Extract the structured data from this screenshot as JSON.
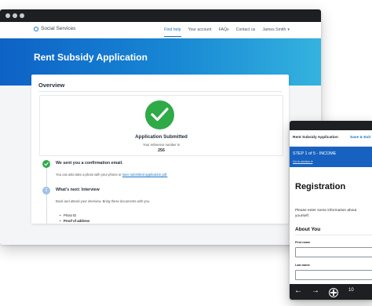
{
  "desktop": {
    "nav": {
      "brand": "Social Services",
      "links": [
        "Find help",
        "Your account",
        "FAQs",
        "Contact us"
      ],
      "user": "James Smith"
    },
    "hero_title": "Rent Subsidy Application",
    "overview": {
      "heading": "Overview",
      "status_title": "Application Submitted",
      "ref_label": "Your reference number is",
      "ref_number": "256"
    },
    "timeline": {
      "step1_title": "We sent you a confirmation email.",
      "step1_text": "You can also take a photo with your phone or",
      "step1_link": "save submitted application pdf.",
      "step2_number": "2",
      "step2_title": "What's next: Interview",
      "step2_text": "Book and attend your interview. Bring these documents with you.",
      "bullets": [
        "Photo ID",
        "Proof of address"
      ],
      "sub_bullets": []
    }
  },
  "mobile": {
    "app_title": "Rent Subsidy Application",
    "save_link": "Save & Exit",
    "step_title": "STEP 1 of 5 - INCOME",
    "step_link": "Go to section ▾",
    "heading": "Registration",
    "description": "Please enter some information about yourself.",
    "section": "About You",
    "fields": [
      "First name",
      "Last name"
    ],
    "bottom_icons": [
      "back-arrow-icon",
      "forward-arrow-icon",
      "add-tab-icon",
      "tabs-icon"
    ],
    "tab_count": "10"
  },
  "colors": {
    "accent": "#1a73c9",
    "success": "#2eaa47",
    "hero_gradient_start": "#0d62c6",
    "hero_gradient_end": "#34b3df"
  }
}
